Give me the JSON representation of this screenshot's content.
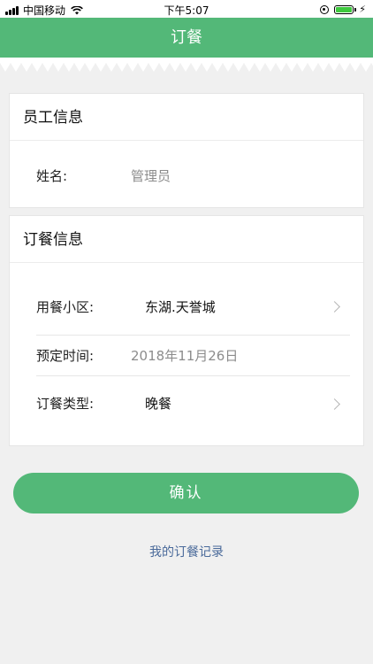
{
  "status_bar": {
    "carrier": "中国移动",
    "time": "下午5:07",
    "battery_level": 1.0,
    "battery_color": "#3ec93e"
  },
  "nav": {
    "title": "订餐",
    "color": "#53b878"
  },
  "employee_card": {
    "title": "员工信息",
    "name_label": "姓名:",
    "name_value": "管理员"
  },
  "order_card": {
    "title": "订餐信息",
    "rows": [
      {
        "label": "用餐小区:",
        "value": "东湖.天誉城",
        "icon": "chevron-right-icon"
      },
      {
        "label": "预定时间:",
        "value": "2018年11月26日"
      },
      {
        "label": "订餐类型:",
        "value": "晚餐",
        "icon": "chevron-right-icon"
      }
    ]
  },
  "actions": {
    "confirm_label": "确认",
    "record_link": "我的订餐记录",
    "link_color": "#4a6a9a"
  }
}
